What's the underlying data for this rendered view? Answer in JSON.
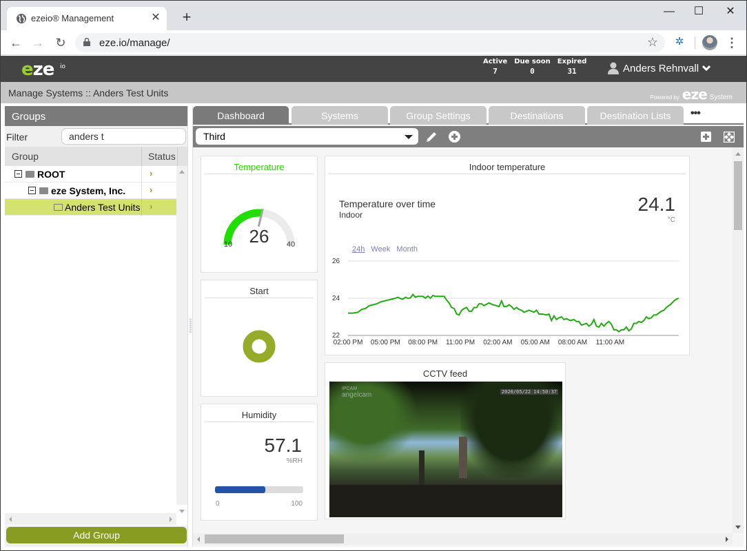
{
  "browser": {
    "tab_title": "ezeio® Management",
    "url": "eze.io/manage/",
    "new_tab_label": "+",
    "window_controls": {
      "minimize": "—",
      "maximize": "☐",
      "close": "✕"
    }
  },
  "app": {
    "logo": {
      "e": "e",
      "ze": "ze",
      "io": "io"
    },
    "stats": [
      {
        "label": "Active",
        "value": "7"
      },
      {
        "label": "Due soon",
        "value": "0"
      },
      {
        "label": "Expired",
        "value": "31"
      }
    ],
    "user_name": "Anders Rehnvall",
    "breadcrumb": "Manage Systems :: Anders Test Units",
    "powered_by": {
      "prefix": "Powered by",
      "brand": "eze",
      "suffix": "System"
    }
  },
  "groups": {
    "title": "Groups",
    "filter_label": "Filter",
    "filter_value": "anders t",
    "columns": {
      "group": "Group",
      "status": "Status"
    },
    "rows": [
      {
        "label": "ROOT",
        "level": 0,
        "expanded": true,
        "status": "›"
      },
      {
        "label": "eze System, Inc.",
        "level": 1,
        "expanded": true,
        "status": "›"
      },
      {
        "label": "Anders Test Units",
        "level": 2,
        "selected": true,
        "status": "›"
      }
    ],
    "add_button": "Add Group"
  },
  "tabs": [
    {
      "label": "Dashboard",
      "active": true
    },
    {
      "label": "Systems"
    },
    {
      "label": "Group Settings"
    },
    {
      "label": "Destinations"
    },
    {
      "label": "Destination Lists"
    }
  ],
  "more_label": "•••",
  "dashboard": {
    "selected": "Third",
    "widgets": {
      "temperature": {
        "title": "Temperature",
        "value": "26",
        "min": "10",
        "max": "40",
        "fraction": 0.533,
        "color": "#22dd00"
      },
      "start": {
        "title": "Start",
        "color": "#97ab2a"
      },
      "humidity": {
        "title": "Humidity",
        "value": "57.1",
        "unit": "%RH",
        "min": "0",
        "max": "100",
        "percent": 57.1,
        "color": "#2354a8"
      },
      "indoor": {
        "title": "Indoor temperature",
        "subtitle": "Temperature over time",
        "location": "Indoor",
        "value": "24.1",
        "unit": "°C",
        "ranges": [
          "24h",
          "Week",
          "Month"
        ]
      },
      "cctv": {
        "title": "CCTV feed",
        "brand_top": "IPCAM",
        "brand": "angelcam",
        "timestamp": "2020/05/22 14:50:37"
      }
    }
  },
  "chart_data": {
    "type": "line",
    "title": "Temperature over time",
    "ylim": [
      22,
      26
    ],
    "yticks": [
      22,
      24,
      26
    ],
    "xticks": [
      "02:00 PM",
      "05:00 PM",
      "08:00 PM",
      "11:00 PM",
      "02:00 AM",
      "05:00 AM",
      "08:00 AM",
      "11:00 AM"
    ],
    "x_hours": [
      0,
      25
    ],
    "series": [
      {
        "name": "Indoor",
        "color": "#22aa11",
        "points": [
          [
            0,
            23.2
          ],
          [
            0.4,
            23.2
          ],
          [
            0.8,
            23.25
          ],
          [
            1.1,
            23.4
          ],
          [
            1.4,
            23.45
          ],
          [
            1.7,
            23.6
          ],
          [
            2.0,
            23.65
          ],
          [
            2.3,
            23.7
          ],
          [
            2.6,
            23.8
          ],
          [
            2.9,
            23.85
          ],
          [
            3.2,
            23.9
          ],
          [
            3.5,
            23.95
          ],
          [
            3.8,
            24.0
          ],
          [
            4.0,
            24.05
          ],
          [
            4.2,
            23.98
          ],
          [
            4.4,
            23.95
          ],
          [
            4.6,
            24.05
          ],
          [
            4.8,
            24.0
          ],
          [
            5.0,
            24.02
          ],
          [
            5.2,
            24.2
          ],
          [
            5.4,
            24.05
          ],
          [
            5.6,
            24.1
          ],
          [
            6.0,
            24.1
          ],
          [
            6.2,
            24.0
          ],
          [
            6.4,
            24.12
          ],
          [
            6.6,
            24.0
          ],
          [
            6.8,
            24.15
          ],
          [
            7.0,
            24.1
          ],
          [
            7.4,
            24.1
          ],
          [
            7.7,
            24.1
          ],
          [
            7.9,
            23.9
          ],
          [
            8.1,
            23.75
          ],
          [
            8.3,
            23.5
          ],
          [
            8.5,
            23.45
          ],
          [
            8.7,
            23.15
          ],
          [
            8.9,
            23.1
          ],
          [
            9.1,
            23.35
          ],
          [
            9.3,
            23.45
          ],
          [
            9.5,
            23.5
          ],
          [
            9.7,
            23.3
          ],
          [
            9.9,
            23.3
          ],
          [
            10.1,
            23.5
          ],
          [
            10.3,
            23.5
          ],
          [
            10.5,
            23.7
          ],
          [
            10.7,
            23.7
          ],
          [
            10.9,
            23.6
          ],
          [
            11.3,
            23.75
          ],
          [
            11.6,
            23.65
          ],
          [
            11.9,
            23.6
          ],
          [
            12.1,
            23.55
          ],
          [
            12.3,
            23.85
          ],
          [
            12.5,
            23.55
          ],
          [
            12.7,
            23.55
          ],
          [
            12.9,
            23.65
          ],
          [
            13.1,
            23.55
          ],
          [
            13.3,
            23.4
          ],
          [
            13.5,
            23.5
          ],
          [
            13.7,
            23.4
          ],
          [
            13.9,
            23.35
          ],
          [
            14.1,
            23.25
          ],
          [
            14.3,
            23.3
          ],
          [
            14.5,
            23.35
          ],
          [
            14.7,
            23.3
          ],
          [
            14.9,
            23.25
          ],
          [
            15.1,
            23.35
          ],
          [
            15.3,
            23.15
          ],
          [
            15.6,
            23.15
          ],
          [
            15.9,
            23.1
          ],
          [
            16.1,
            23.15
          ],
          [
            16.3,
            22.8
          ],
          [
            16.5,
            23.05
          ],
          [
            16.7,
            22.85
          ],
          [
            16.9,
            22.95
          ],
          [
            17.1,
            23.0
          ],
          [
            17.3,
            22.85
          ],
          [
            17.5,
            22.9
          ],
          [
            17.8,
            22.8
          ],
          [
            18.1,
            22.85
          ],
          [
            18.3,
            22.75
          ],
          [
            18.5,
            22.75
          ],
          [
            18.7,
            22.55
          ],
          [
            18.9,
            22.6
          ],
          [
            19.1,
            22.65
          ],
          [
            19.3,
            22.5
          ],
          [
            19.5,
            22.6
          ],
          [
            19.7,
            22.85
          ],
          [
            19.9,
            22.5
          ],
          [
            20.1,
            22.45
          ],
          [
            20.3,
            22.65
          ],
          [
            20.5,
            22.5
          ],
          [
            20.7,
            22.65
          ],
          [
            20.9,
            22.75
          ],
          [
            21.1,
            22.6
          ],
          [
            21.3,
            22.3
          ],
          [
            21.5,
            22.3
          ],
          [
            21.7,
            22.2
          ],
          [
            21.9,
            22.3
          ],
          [
            22.1,
            22.3
          ],
          [
            22.3,
            22.45
          ],
          [
            22.5,
            22.25
          ],
          [
            22.7,
            22.35
          ],
          [
            22.9,
            22.65
          ],
          [
            23.1,
            22.65
          ],
          [
            23.3,
            22.75
          ],
          [
            23.5,
            22.7
          ],
          [
            23.7,
            22.8
          ],
          [
            23.9,
            23.0
          ],
          [
            24.1,
            22.9
          ],
          [
            24.3,
            22.95
          ],
          [
            24.5,
            23.1
          ],
          [
            24.7,
            23.1
          ],
          [
            24.9,
            23.2
          ],
          [
            25.1,
            23.3
          ],
          [
            25.3,
            23.35
          ],
          [
            25.5,
            23.5
          ],
          [
            25.7,
            23.6
          ],
          [
            25.9,
            23.7
          ],
          [
            26.1,
            23.85
          ],
          [
            26.3,
            23.95
          ],
          [
            26.5,
            24.0
          ]
        ]
      }
    ]
  }
}
